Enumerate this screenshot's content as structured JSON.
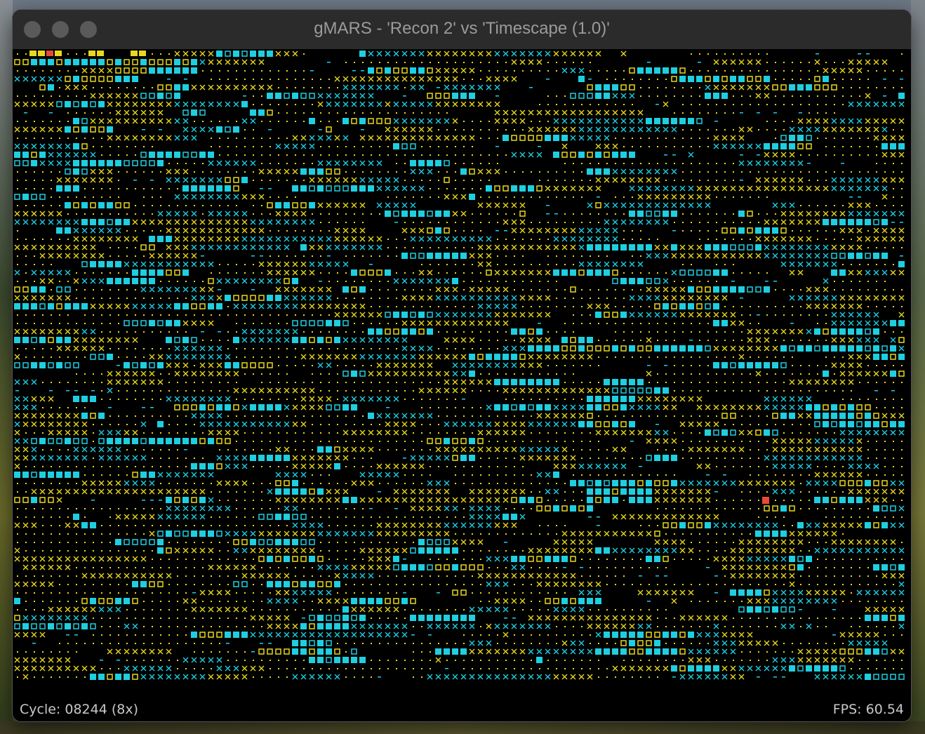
{
  "window": {
    "title": "gMARS - 'Recon 2' vs 'Timescape (1.0)'",
    "controls": [
      "close",
      "minimize",
      "zoom"
    ]
  },
  "status": {
    "cycle": "Cycle: 08244 (8x)",
    "fps": "FPS: 60.54"
  },
  "core_view": {
    "colors": {
      "background": "#000000",
      "warrior1": "#e8d81e",
      "warrior2": "#1ecfe0",
      "pc_marker": "#e84a3a",
      "dat_dim": "#888800"
    },
    "legend": {
      "empty": "dot",
      "written": "x",
      "executed": "solid square",
      "instruction": "outlined square",
      "read": "dash",
      "jump": "plus"
    }
  }
}
